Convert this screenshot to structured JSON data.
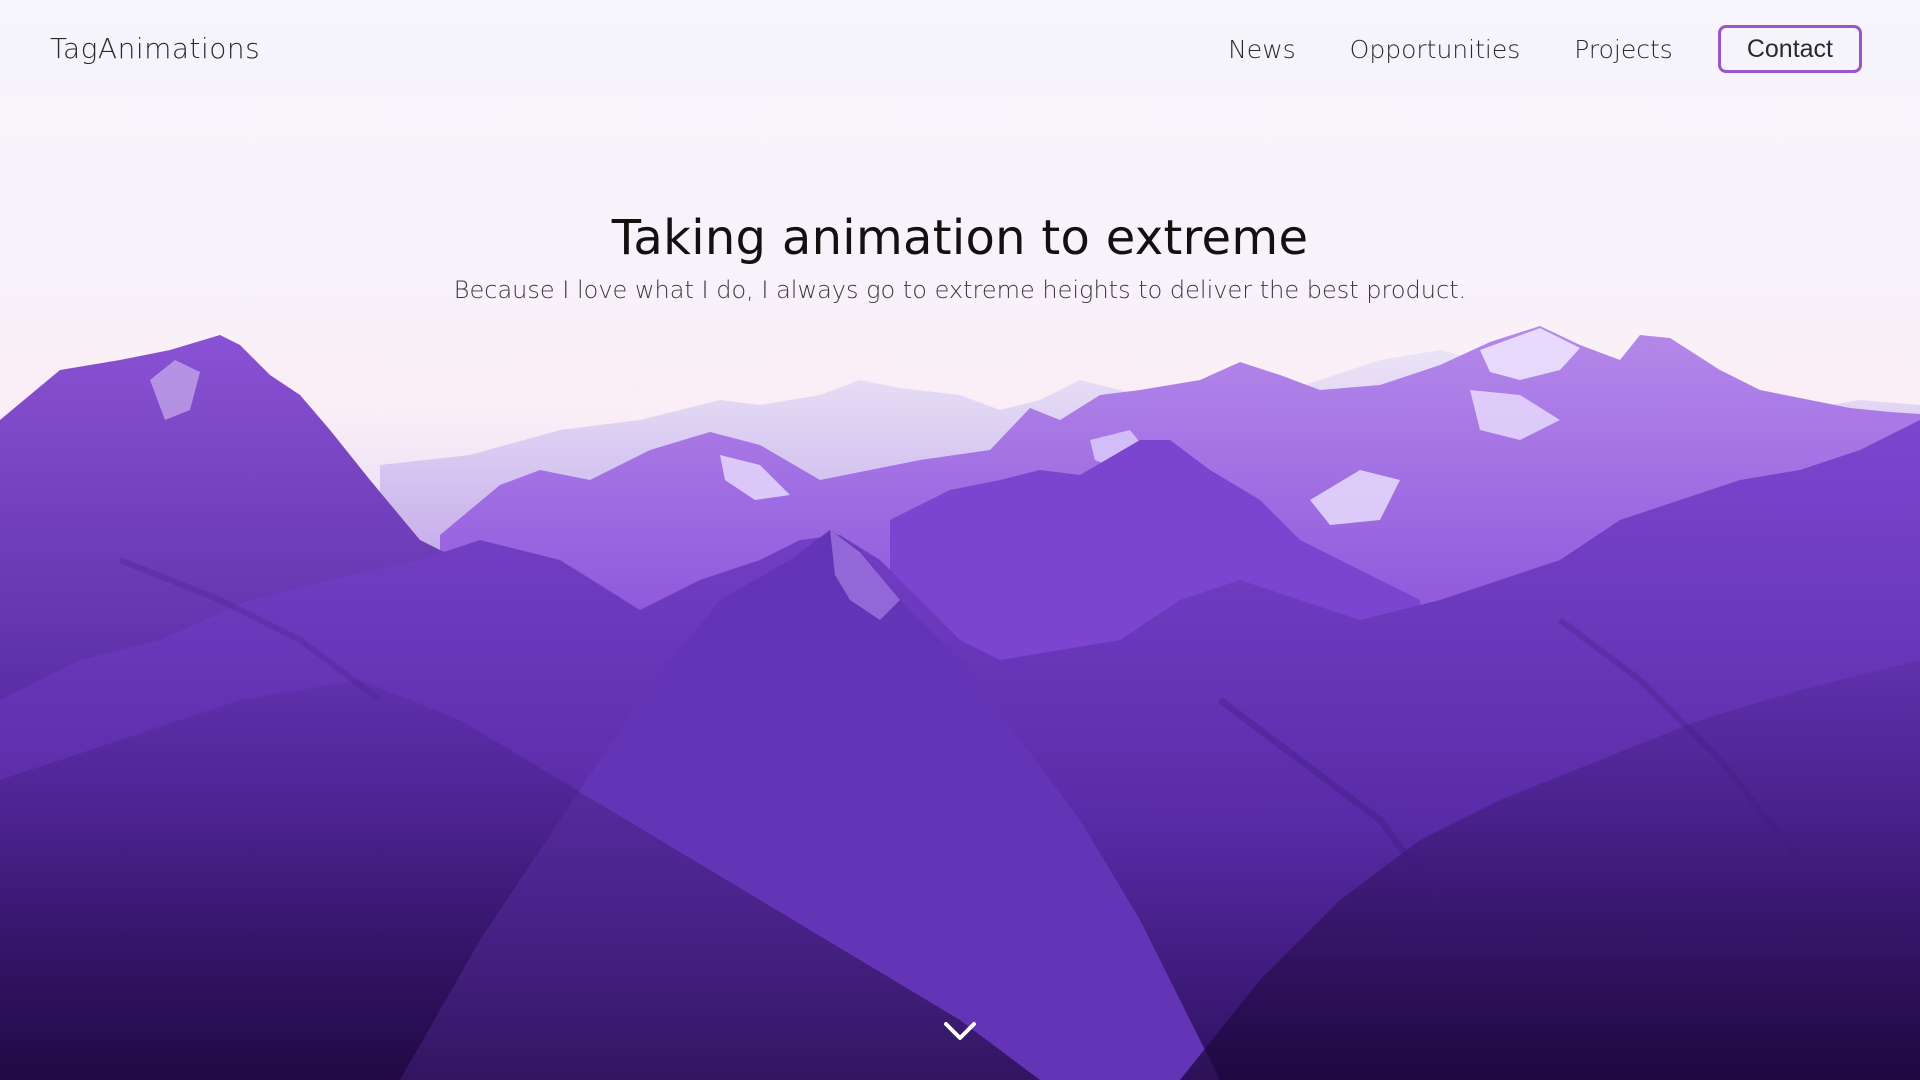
{
  "header": {
    "brand": "TagAnimations",
    "nav": [
      {
        "label": "News"
      },
      {
        "label": "Opportunities"
      },
      {
        "label": "Projects"
      }
    ],
    "contact_label": "Contact"
  },
  "hero": {
    "title": "Taking animation to extreme",
    "subtitle": "Because I love what I do, I always go to extreme heights to deliver the best product."
  },
  "icons": {
    "scroll": "chevron-down-icon"
  },
  "colors": {
    "accent": "#9a55c8",
    "mountain_dark": "#3c1a78",
    "mountain_mid": "#7a44d0",
    "mountain_light": "#b68be8",
    "snow": "#f1e9ff"
  }
}
